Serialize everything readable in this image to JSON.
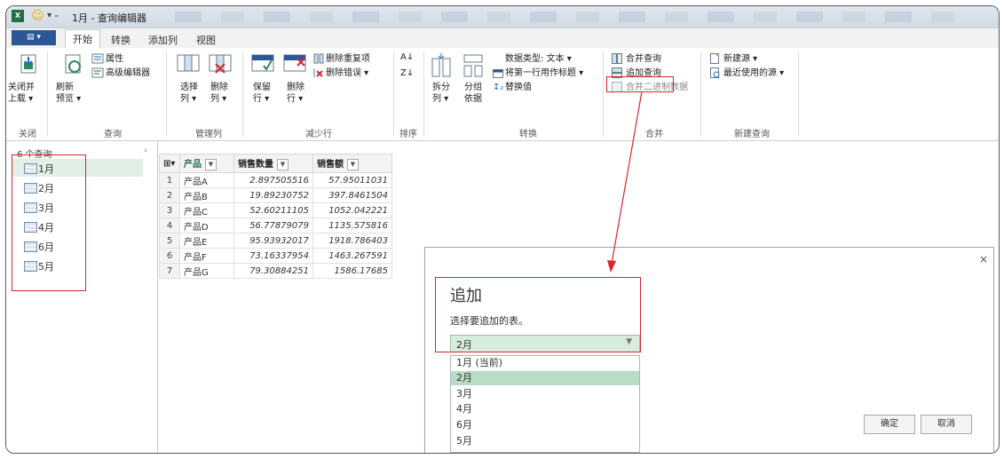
{
  "titlebar": {
    "app_badge": "X",
    "quick_access": "▾ ₌",
    "title": "1月 - 查询编辑器"
  },
  "tabs": [
    {
      "label": "开始",
      "active": true
    },
    {
      "label": "转换"
    },
    {
      "label": "添加列"
    },
    {
      "label": "视图"
    }
  ],
  "file_button": "▤ ▾",
  "ribbon": {
    "close_group": {
      "button": "关闭并\n上载 ▾",
      "label": "关闭"
    },
    "query_group": {
      "refresh": "刷新\n预览 ▾",
      "properties": "属性",
      "advanced_editor": "高级编辑器",
      "label": "查询"
    },
    "columns_group": {
      "choose": "选择\n列 ▾",
      "remove": "删除\n列 ▾",
      "label": "管理列"
    },
    "rows_group": {
      "keep": "保留\n行 ▾",
      "remove": "删除\n行 ▾",
      "remove_duplicates": "删除重复项",
      "remove_errors": "删除错误 ▾",
      "label": "减少行"
    },
    "sort_group": {
      "label": "排序"
    },
    "transform_group": {
      "split": "拆分\n列 ▾",
      "group_by": "分组\n依据",
      "data_type": "数据类型: 文本 ▾",
      "first_row_header": "将第一行用作标题 ▾",
      "replace_values": "替换值",
      "label": "转换"
    },
    "combine_group": {
      "merge": "合并查询",
      "append": "追加查询",
      "combine_binary": "合并二进制数据",
      "label": "合并"
    },
    "new_query_group": {
      "new_source": "新建源 ▾",
      "recent_sources": "最近使用的源 ▾",
      "label": "新建查询"
    }
  },
  "queries": {
    "header": "6 个查询",
    "items": [
      "1月",
      "2月",
      "3月",
      "4月",
      "6月",
      "5月"
    ],
    "selected": "1月"
  },
  "table": {
    "columns": [
      "产品",
      "销售数量",
      "销售额"
    ],
    "rows": [
      [
        "1",
        "产品A",
        "2.897505516",
        "57.95011031"
      ],
      [
        "2",
        "产品B",
        "19.89230752",
        "397.8461504"
      ],
      [
        "3",
        "产品C",
        "52.60211105",
        "1052.042221"
      ],
      [
        "4",
        "产品D",
        "56.77879079",
        "1135.575816"
      ],
      [
        "5",
        "产品E",
        "95.93932017",
        "1918.786403"
      ],
      [
        "6",
        "产品F",
        "73.16337954",
        "1463.267591"
      ],
      [
        "7",
        "产品G",
        "79.30884251",
        "1586.17685"
      ]
    ]
  },
  "dialog": {
    "title": "追加",
    "description": "选择要追加的表。",
    "selected_value": "2月",
    "options": [
      "1月 (当前)",
      "2月",
      "3月",
      "4月",
      "6月",
      "5月"
    ],
    "highlighted": "2月",
    "ok": "确定",
    "cancel": "取消",
    "close": "×"
  },
  "colors": {
    "accent_red": "#d9262a",
    "selection_green": "#b9dcc4",
    "excel_green": "#1f7044"
  }
}
